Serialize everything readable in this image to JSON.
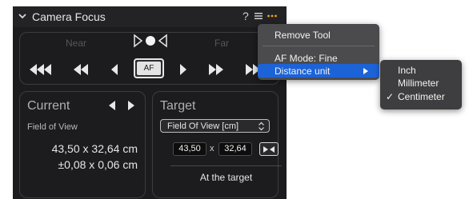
{
  "header": {
    "title": "Camera Focus",
    "help": "?"
  },
  "focus_scale": {
    "near_label": "Near",
    "far_label": "Far"
  },
  "nav": {
    "af_label": "AF"
  },
  "current": {
    "title": "Current",
    "mode_label": "Field of View",
    "value_line1": "43,50 x 32,64 cm",
    "value_line2": "±0,08 x 0,06 cm"
  },
  "target": {
    "title": "Target",
    "select_value": "Field Of View [cm]",
    "width_value": "43,50",
    "separator": "x",
    "height_value": "32,64",
    "status": "At the target"
  },
  "menu": {
    "items": [
      "Remove Tool",
      "AF Mode: Fine",
      "Distance unit"
    ]
  },
  "submenu": {
    "items": [
      "Inch",
      "Millimeter",
      "Centimeter"
    ],
    "checked_mark": "✓"
  },
  "colors": {
    "panel_bg": "#1c1c1e",
    "accent_highlight": "#1d63d8",
    "more_icon": "#f2a21b"
  }
}
